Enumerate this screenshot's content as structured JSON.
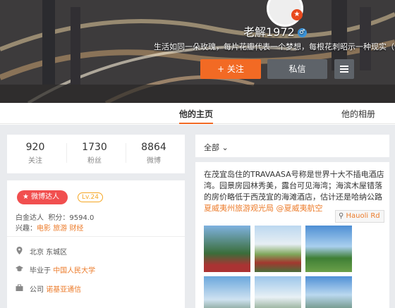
{
  "profile": {
    "name": "老解1972",
    "motto": "生活如同一朵玫瑰，每片花瓣代表一个梦想，每根花刺昭示一种现实（快",
    "follow_label": "+ 关注",
    "message_label": "私信"
  },
  "tabs": [
    {
      "label": "他的主页",
      "active": true
    },
    {
      "label": "他的相册",
      "active": false
    }
  ],
  "stats": [
    {
      "value": "920",
      "label": "关注"
    },
    {
      "value": "1730",
      "label": "粉丝"
    },
    {
      "value": "8864",
      "label": "微博"
    }
  ],
  "badge": {
    "talent_label": "微博达人",
    "level": "Lv.24"
  },
  "info": {
    "level_name": "白金达人",
    "points_label": "积分：",
    "points": "9594.0",
    "interests_label": "兴趣：",
    "interests": [
      "电影",
      "旅游",
      "财经"
    ],
    "location": "北京 东城区",
    "school_prefix": "毕业于",
    "school": "中国人民大学",
    "company_prefix": "公司",
    "company": "诺基亚通信"
  },
  "feed": {
    "filter_label": "全部",
    "post_lines": [
      "在茂宜岛住的TRAVAASA号称是世界十大不插电酒店",
      "湾。园景房园林秀美，露台可见海湾；海滨木屋错落",
      "的房价略低于西茂宜的海滩酒店，估计还是哈纳公路"
    ],
    "mentions": "夏威夷州旅游观光局 @夏威夷航空",
    "location_tag": "Hauoli Rd"
  },
  "colors": {
    "accent": "#f26a24",
    "talent": "#f14f4f",
    "link": "#ec7b2a"
  }
}
